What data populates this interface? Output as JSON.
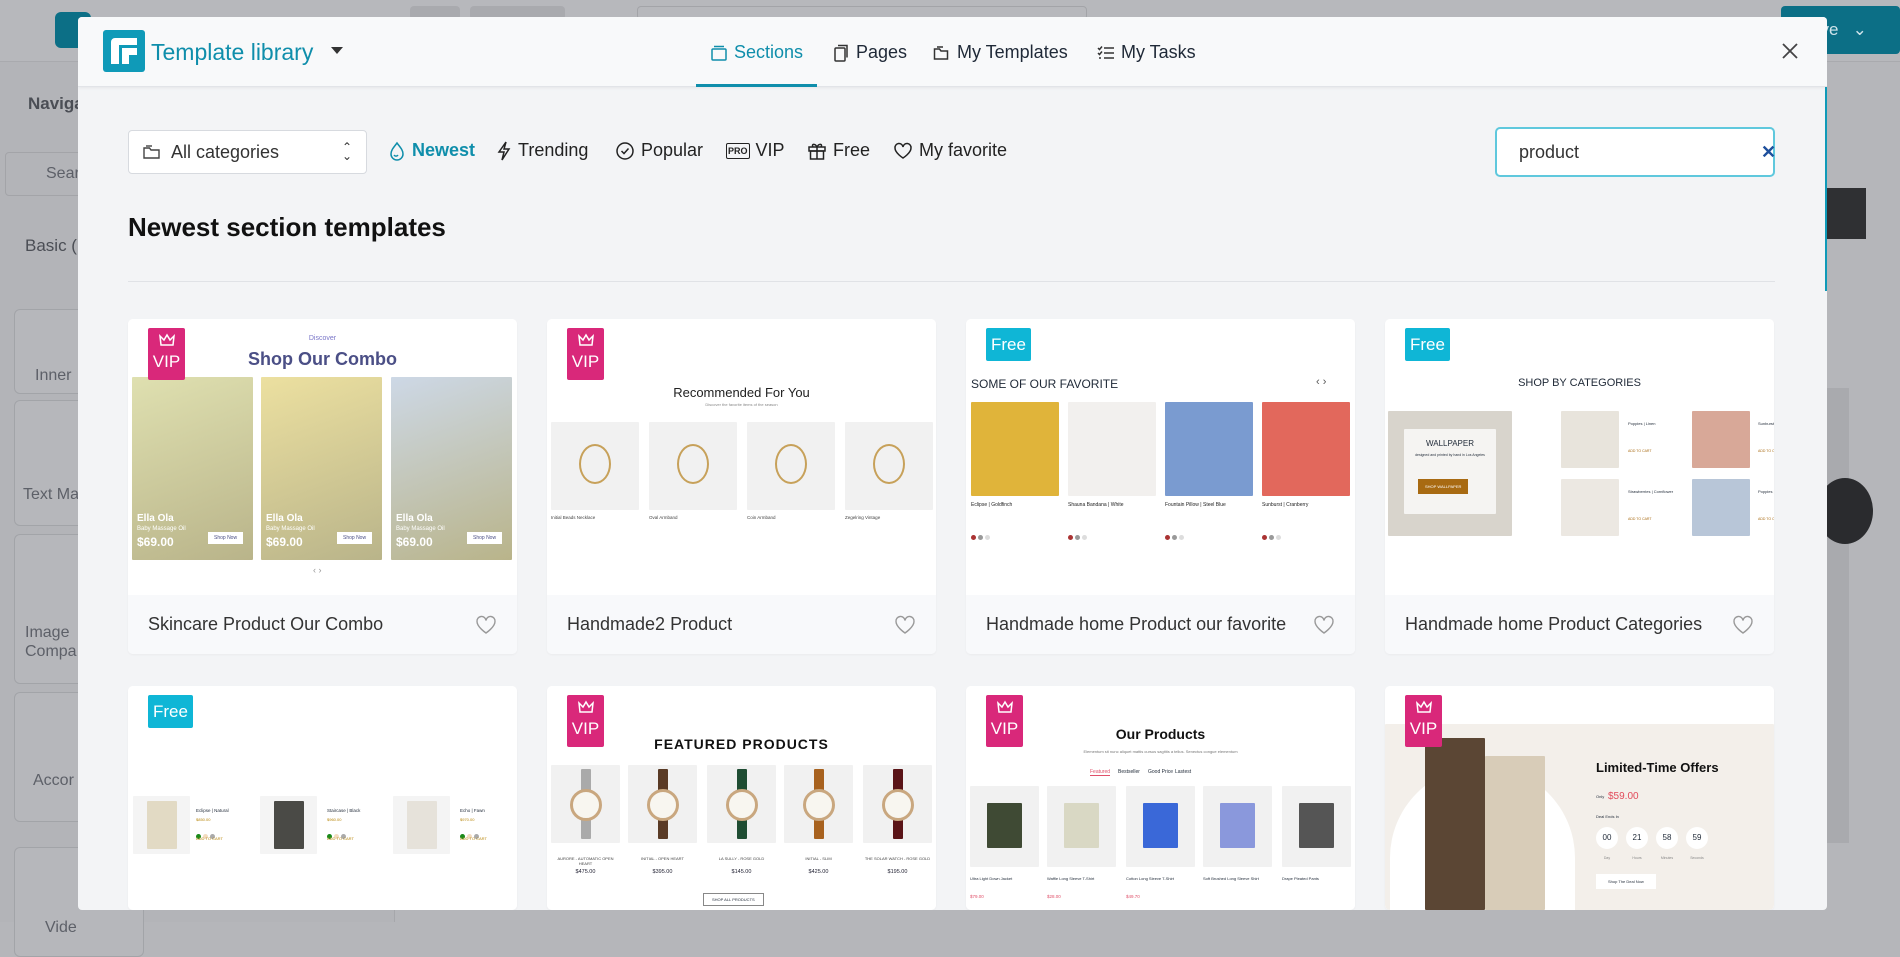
{
  "background": {
    "navigator": "Naviga",
    "search": "Sear",
    "basic": "Basic (",
    "widgets": [
      "Inner",
      "Text Ma",
      "Image\nCompa",
      "Accor",
      "Vide"
    ],
    "save": "ave"
  },
  "modal": {
    "title": "Template library",
    "tabs": [
      {
        "label": "Sections",
        "icon": "sections-icon",
        "active": true
      },
      {
        "label": "Pages",
        "icon": "pages-icon"
      },
      {
        "label": "My Templates",
        "icon": "folder-icon"
      },
      {
        "label": "My Tasks",
        "icon": "tasks-icon"
      }
    ],
    "category_select": "All categories",
    "filters": [
      {
        "label": "Newest",
        "active": true
      },
      {
        "label": "Trending"
      },
      {
        "label": "Popular"
      },
      {
        "label": "VIP",
        "pro": "PRO"
      },
      {
        "label": "Free"
      },
      {
        "label": "My favorite"
      }
    ],
    "search": {
      "value": "product",
      "placeholder": ""
    },
    "heading": "Newest section templates"
  },
  "colors": {
    "accent": "#0f8eab",
    "vip": "#d9287a",
    "free": "#0fb6d6"
  },
  "cards": [
    {
      "name": "Skincare Product Our Combo",
      "badge": "VIP",
      "thumb": {
        "eyebrow": "Discover",
        "title": "Shop Our Combo",
        "brand": "Ella Ola",
        "product": "Baby Massage Oil",
        "price": "$69.00",
        "cta": "Shop Now"
      }
    },
    {
      "name": "Handmade2 Product",
      "badge": "VIP",
      "thumb": {
        "title": "Recommended For You",
        "subtitle": "Discover the favorite items of the season",
        "items": [
          "Initial Beads Necklace",
          "Oval Armband",
          "Coin Armband",
          "Zegelring Vintage"
        ]
      }
    },
    {
      "name": "Handmade home Product our favorite",
      "badge": "Free",
      "thumb": {
        "title": "SOME OF OUR FAVORITE",
        "items": [
          "Eclipse | Goldfinch",
          "Shauna Bandana | White",
          "Fountain Pillow | Steel Blue",
          "Sunburst | Cranberry"
        ]
      }
    },
    {
      "name": "Handmade home Product Categories",
      "badge": "Free",
      "thumb": {
        "title": "SHOP BY CATEGORIES",
        "feature": "WALLPAPER",
        "feature_sub": "designed and printed by hand in Los Angeles",
        "cta": "SHOP WALLPAPER",
        "items": [
          "Poppies | Linen",
          "Sunburst | Peony",
          "Strawberries | Cornflower",
          "Poppies | Periwinkle"
        ],
        "add": "ADD TO CART"
      }
    },
    {
      "name": "",
      "badge": "Free",
      "thumb": {
        "items": [
          "Eclipse | Natural",
          "Staircase | Black",
          "Echo | Fawn"
        ],
        "prices": [
          "$850.00",
          "$960.00",
          "$970.00"
        ],
        "add": "ADD TO CART"
      }
    },
    {
      "name": "",
      "badge": "VIP",
      "thumb": {
        "title": "FEATURED PRODUCTS",
        "items": [
          "AURORE - AUTOMATIC OPEN HEART",
          "INITIAL - OPEN HEART",
          "LA SULLY - ROSE GOLD",
          "INITIAL - SLIM",
          "THE SOLAR WATCH - ROSE GOLD"
        ],
        "prices": [
          "$475.00",
          "$395.00",
          "$145.00",
          "$425.00",
          "$195.00"
        ],
        "cta": "SHOP ALL PRODUCTS"
      }
    },
    {
      "name": "",
      "badge": "VIP",
      "thumb": {
        "title": "Our Products",
        "subtitle": "Elementum sit nunc aliquet mattis cursus sagittis a tellus. Senectus congue elementum",
        "tabs": [
          "Featured",
          "Bestseller",
          "Good Price",
          "Lastest"
        ],
        "items": [
          "Ultra Light Down Jacket",
          "Waffle Long Sleeve T-Shirt",
          "Cotton Long Sleeve T-Shirt",
          "Soft Brushed Long Sleeve Shirt",
          "Drape Pleated Pants"
        ],
        "prices": [
          "$79.00",
          "$28.00",
          "$49.70",
          "",
          ""
        ]
      }
    },
    {
      "name": "",
      "badge": "VIP",
      "thumb": {
        "title": "Limited-Time Offers",
        "only": "Only",
        "price": "$59.00",
        "deal": "Deal Ends In",
        "countdown": [
          {
            "v": "00",
            "l": "Day"
          },
          {
            "v": "21",
            "l": "Hours"
          },
          {
            "v": "58",
            "l": "Minutes"
          },
          {
            "v": "59",
            "l": "Seconds"
          }
        ],
        "cta": "Shop The Deal Now"
      }
    }
  ]
}
